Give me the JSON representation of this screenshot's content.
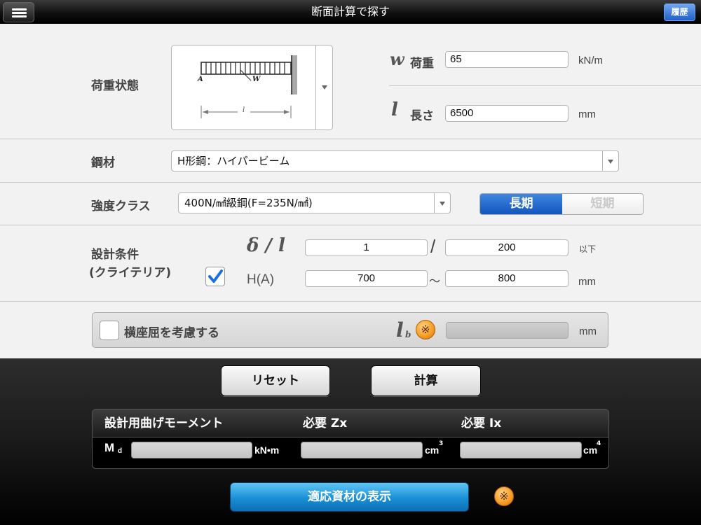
{
  "header": {
    "title": "断面計算で探す",
    "history_label": "履歴"
  },
  "load": {
    "label": "荷重状態",
    "diagram_left_label": "A",
    "diagram_w_label": "W",
    "diagram_span_label": "l",
    "w_symbol": "w",
    "w_label": "荷重",
    "w_value": "65",
    "w_unit": "kN/m",
    "l_symbol": "l",
    "l_label": "長さ",
    "l_value": "6500",
    "l_unit": "mm"
  },
  "steel": {
    "label": "鋼材",
    "value": "H形鋼：ハイパービーム"
  },
  "strength": {
    "label": "強度クラス",
    "value": "400N/㎟級鋼(F=235N/㎟)",
    "long_label": "長期",
    "short_label": "短期"
  },
  "criteria": {
    "label_line1": "設計条件",
    "label_line2": "(クライテリア)",
    "checked": true,
    "ratio_symbol": "δ / l",
    "ratio_num": "1",
    "ratio_sep": "/",
    "ratio_den": "200",
    "ratio_unit": "以下",
    "h_label": "H(A)",
    "h_min": "700",
    "h_sep": "～",
    "h_max": "800",
    "h_unit": "mm"
  },
  "buckling": {
    "label": "横座屈を考慮する",
    "checked": false,
    "symbol": "l",
    "symbol_sub": "b",
    "note_mark": "※",
    "value": "",
    "unit": "mm"
  },
  "actions": {
    "reset_label": "リセット",
    "calc_label": "計算"
  },
  "results": {
    "col1": "設計用曲げモーメント",
    "col2": "必要 Zx",
    "col3": "必要 Ix",
    "md_label": "M",
    "md_sub": "d",
    "md_unit": "kN•m",
    "zx_unit": "cm",
    "zx_exp": "3",
    "ix_unit": "cm",
    "ix_exp": "4"
  },
  "footer": {
    "show_label": "適応資材の表示",
    "note_mark": "※"
  }
}
